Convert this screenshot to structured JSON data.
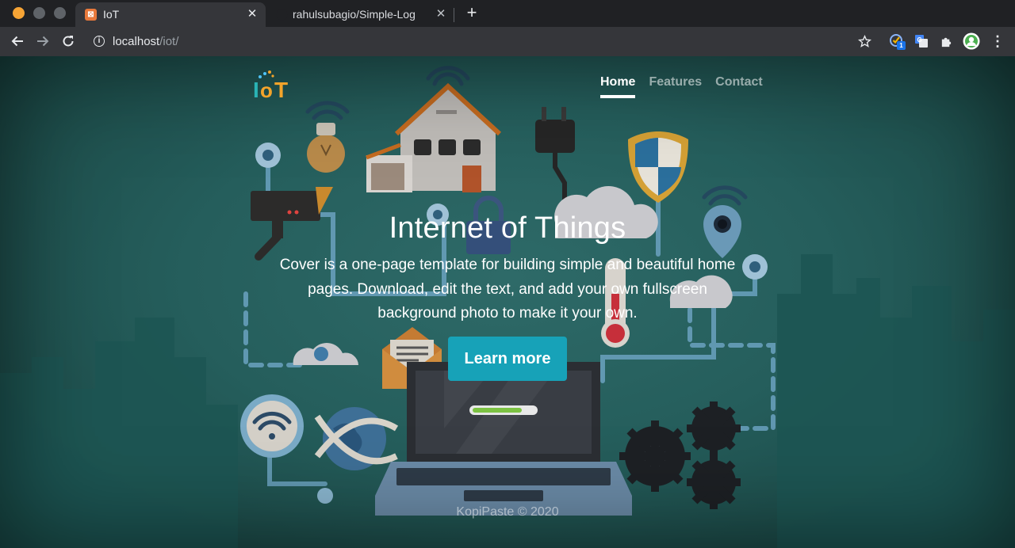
{
  "browser": {
    "tabs": [
      {
        "title": "IoT",
        "favicon": "xampp-icon",
        "active": true
      },
      {
        "title": "rahulsubagio/Simple-Log",
        "favicon": "github-icon",
        "active": false
      }
    ],
    "url_host": "localhost",
    "url_path": "/iot/",
    "extension_badge": "1"
  },
  "site": {
    "logo_text": "IoT",
    "nav": [
      {
        "label": "Home",
        "active": true
      },
      {
        "label": "Features",
        "active": false
      },
      {
        "label": "Contact",
        "active": false
      }
    ],
    "hero": {
      "title": "Internet of Things",
      "lead": "Cover is a one-page template for building simple and beautiful home pages. Download, edit the text, and add your own fullscreen background photo to make it your own.",
      "button_label": "Learn more"
    },
    "footer": "KopiPaste © 2020"
  },
  "colors": {
    "accent": "#17a2b8",
    "background": "#255e5c",
    "logo_teal": "#2ab3b5",
    "logo_orange": "#f4a42b"
  }
}
